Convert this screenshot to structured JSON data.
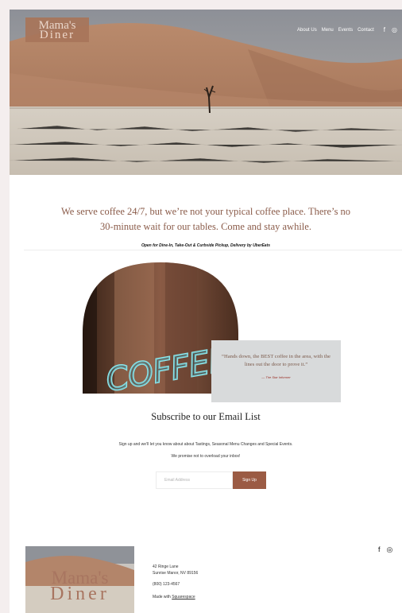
{
  "brand": {
    "line1": "Mama's",
    "line2": "Diner"
  },
  "nav": {
    "items": [
      {
        "label": "About Us"
      },
      {
        "label": "Menu"
      },
      {
        "label": "Events"
      },
      {
        "label": "Contact"
      }
    ],
    "social": {
      "facebook": "f",
      "instagram": "◎"
    }
  },
  "intro": {
    "lead": "We serve coffee 24/7, but we’re not your typical coffee place. There’s no 30-minute wait for our tables. Come and stay awhile.",
    "note": "Open for Dine-In, Take-Out & Curbside Pickup, Delivery by UberEats"
  },
  "feature": {
    "sign_text": "COFFEE",
    "quote": "“Hands down, the BEST coffee in the area, with the lines out the door to prove it.”",
    "cite": "— The Star Informer"
  },
  "subscribe": {
    "title": "Subscribe to our Email List",
    "text1": "Sign up and we’ll let you know about about Tastings, Seasonal Menu Changes and Special Events.",
    "text2": "We promise not to overload your inbox!",
    "email_placeholder": "Email Address",
    "button": "Sign Up"
  },
  "footer": {
    "address1": "42 Ringe Lane",
    "address2": "Sunrise Manor, NV 89156",
    "phone": "(800) 123-4567",
    "made_prefix": "Made with ",
    "made_link": "Squarespace",
    "social": {
      "facebook": "f",
      "instagram": "◎"
    }
  },
  "colors": {
    "accent": "#9b5b44",
    "heading": "#8a5b49",
    "card": "#d8dadb"
  }
}
